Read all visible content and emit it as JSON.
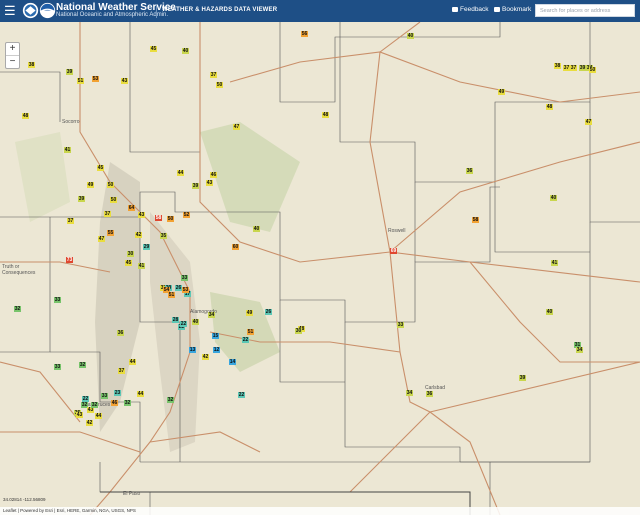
{
  "header": {
    "title": "National Weather Service",
    "subtitle": "National Oceanic and Atmospheric Admin.",
    "viewer_name": "WEATHER & HAZARDS DATA VIEWER",
    "feedback_label": "Feedback",
    "bookmark_label": "Bookmark",
    "search_placeholder": "Search for places or address"
  },
  "zoom": {
    "in_label": "+",
    "out_label": "−"
  },
  "cities": [
    "Socorro",
    "Truth or Consequences",
    "Roswell",
    "Alamogordo",
    "Carlsbad",
    "Las Cruces",
    "El Paso"
  ],
  "markers": [
    {
      "v": "45",
      "c": "yellow"
    },
    {
      "v": "40",
      "c": "olive"
    },
    {
      "v": "56",
      "c": "orange"
    },
    {
      "v": "40",
      "c": "olive"
    },
    {
      "v": "38",
      "c": "yellow"
    },
    {
      "v": "39",
      "c": "olive"
    },
    {
      "v": "37",
      "c": "yellow"
    },
    {
      "v": "53",
      "c": "orange"
    },
    {
      "v": "51",
      "c": "yellow"
    },
    {
      "v": "43",
      "c": "yellow"
    },
    {
      "v": "50",
      "c": "yellow"
    },
    {
      "v": "38",
      "c": "yellow"
    },
    {
      "v": "37",
      "c": "yellow"
    },
    {
      "v": "37",
      "c": "yellow"
    },
    {
      "v": "39",
      "c": "olive"
    },
    {
      "v": "34",
      "c": "olive"
    },
    {
      "v": "50",
      "c": "yellow"
    },
    {
      "v": "49",
      "c": "yellow"
    },
    {
      "v": "48",
      "c": "yellow"
    },
    {
      "v": "48",
      "c": "yellow"
    },
    {
      "v": "48",
      "c": "yellow"
    },
    {
      "v": "47",
      "c": "yellow"
    },
    {
      "v": "47",
      "c": "yellow"
    },
    {
      "v": "41",
      "c": "olive"
    },
    {
      "v": "45",
      "c": "yellow"
    },
    {
      "v": "44",
      "c": "yellow"
    },
    {
      "v": "43",
      "c": "yellow"
    },
    {
      "v": "46",
      "c": "yellow"
    },
    {
      "v": "39",
      "c": "olive"
    },
    {
      "v": "36",
      "c": "olive"
    },
    {
      "v": "49",
      "c": "yellow"
    },
    {
      "v": "50",
      "c": "yellow"
    },
    {
      "v": "50",
      "c": "yellow"
    },
    {
      "v": "40",
      "c": "olive"
    },
    {
      "v": "39",
      "c": "olive"
    },
    {
      "v": "37",
      "c": "yellow"
    },
    {
      "v": "64",
      "c": "orange"
    },
    {
      "v": "50",
      "c": "orange"
    },
    {
      "v": "52",
      "c": "orange"
    },
    {
      "v": "58",
      "c": "orange"
    },
    {
      "v": "37",
      "c": "yellow"
    },
    {
      "v": "58",
      "c": "red"
    },
    {
      "v": "43",
      "c": "yellow"
    },
    {
      "v": "55",
      "c": "orange"
    },
    {
      "v": "29",
      "c": "teal"
    },
    {
      "v": "30",
      "c": "olive"
    },
    {
      "v": "40",
      "c": "olive"
    },
    {
      "v": "42",
      "c": "yellow"
    },
    {
      "v": "35",
      "c": "olive"
    },
    {
      "v": "47",
      "c": "yellow"
    },
    {
      "v": "60",
      "c": "orange"
    },
    {
      "v": "45",
      "c": "yellow"
    },
    {
      "v": "69",
      "c": "red"
    },
    {
      "v": "73",
      "c": "red"
    },
    {
      "v": "41",
      "c": "olive"
    },
    {
      "v": "33",
      "c": "olive"
    },
    {
      "v": "32",
      "c": "green"
    },
    {
      "v": "41",
      "c": "olive"
    },
    {
      "v": "33",
      "c": "green"
    },
    {
      "v": "37",
      "c": "yellow"
    },
    {
      "v": "29",
      "c": "teal"
    },
    {
      "v": "26",
      "c": "teal"
    },
    {
      "v": "17",
      "c": "teal"
    },
    {
      "v": "40",
      "c": "olive"
    },
    {
      "v": "33",
      "c": "green"
    },
    {
      "v": "22",
      "c": "teal"
    },
    {
      "v": "54",
      "c": "orange"
    },
    {
      "v": "53",
      "c": "orange"
    },
    {
      "v": "51",
      "c": "orange"
    },
    {
      "v": "49",
      "c": "yellow"
    },
    {
      "v": "48",
      "c": "yellow"
    },
    {
      "v": "26",
      "c": "teal"
    },
    {
      "v": "34",
      "c": "olive"
    },
    {
      "v": "51",
      "c": "orange"
    },
    {
      "v": "36",
      "c": "olive"
    },
    {
      "v": "28",
      "c": "teal"
    },
    {
      "v": "22",
      "c": "teal"
    },
    {
      "v": "22",
      "c": "teal"
    },
    {
      "v": "13",
      "c": "blue"
    },
    {
      "v": "15",
      "c": "blue"
    },
    {
      "v": "12",
      "c": "blue"
    },
    {
      "v": "14",
      "c": "blue"
    },
    {
      "v": "40",
      "c": "olive"
    },
    {
      "v": "31",
      "c": "green"
    },
    {
      "v": "34",
      "c": "olive"
    },
    {
      "v": "30",
      "c": "olive"
    },
    {
      "v": "42",
      "c": "yellow"
    },
    {
      "v": "44",
      "c": "yellow"
    },
    {
      "v": "32",
      "c": "green"
    },
    {
      "v": "37",
      "c": "yellow"
    },
    {
      "v": "33",
      "c": "green"
    },
    {
      "v": "33",
      "c": "green"
    },
    {
      "v": "23",
      "c": "teal"
    },
    {
      "v": "22",
      "c": "teal"
    },
    {
      "v": "44",
      "c": "yellow"
    },
    {
      "v": "46",
      "c": "orange"
    },
    {
      "v": "39",
      "c": "olive"
    },
    {
      "v": "36",
      "c": "olive"
    },
    {
      "v": "34",
      "c": "olive"
    },
    {
      "v": "32",
      "c": "green"
    },
    {
      "v": "32",
      "c": "green"
    },
    {
      "v": "32",
      "c": "green"
    },
    {
      "v": "22",
      "c": "teal"
    },
    {
      "v": "36",
      "c": "olive"
    },
    {
      "v": "43",
      "c": "yellow"
    },
    {
      "v": "44",
      "c": "yellow"
    },
    {
      "v": "42",
      "c": "yellow"
    },
    {
      "v": "43",
      "c": "yellow"
    },
    {
      "v": "32",
      "c": "green"
    }
  ],
  "coords_readout": "34.02814 -112.56809",
  "attribution": "Leaflet | Powered by Esri | Esri, HERE, Garmin, NGA, USGS, NPS",
  "colors": {
    "header_bg": "#1e4f86",
    "map_bg": "#ece7d4",
    "road": "#c98f6a",
    "county": "#555555"
  }
}
